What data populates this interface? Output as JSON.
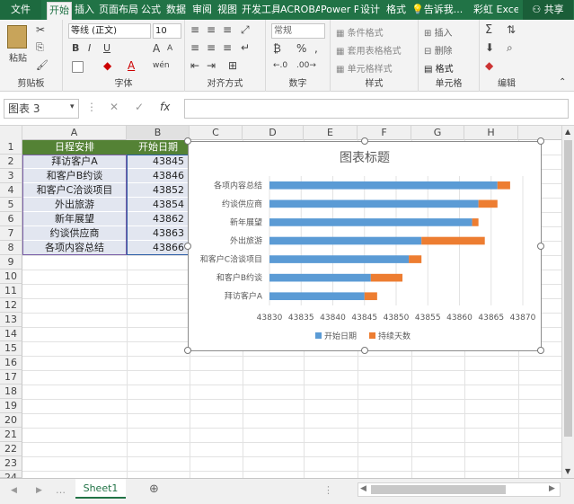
{
  "tabs": {
    "file": "文件",
    "home": "开始",
    "insert": "插入",
    "page_layout": "页面布局",
    "formulas": "公式",
    "data": "数据",
    "review": "审阅",
    "view": "视图",
    "developer": "开发工具",
    "acrobat": "ACROBAT",
    "powerpivot": "Power Pivot",
    "design": "设计",
    "format": "格式",
    "tell_me": "告诉我...",
    "user": "彩虹 Excel",
    "share": "共享"
  },
  "ribbon": {
    "clipboard": {
      "label": "剪贴板",
      "paste": "粘贴"
    },
    "font": {
      "label": "字体",
      "name": "等线 (正文)",
      "size": "10",
      "bold": "B",
      "italic": "I",
      "underline": "U",
      "grow": "A",
      "shrink": "A",
      "wen": "wén"
    },
    "alignment": {
      "label": "对齐方式"
    },
    "number": {
      "label": "数字",
      "format": "常规",
      "percent": "%",
      "comma": ","
    },
    "styles": {
      "label": "样式",
      "conditional": "条件格式",
      "table": "套用表格格式",
      "cell": "单元格样式"
    },
    "cells": {
      "label": "单元格",
      "insert": "插入",
      "delete": "删除",
      "format": "格式"
    },
    "editing": {
      "label": "编辑",
      "sigma": "Σ"
    }
  },
  "formula_bar": {
    "name_box": "图表 3",
    "fx": "fx",
    "value": ""
  },
  "columns": [
    "A",
    "B",
    "C",
    "D",
    "E",
    "F",
    "G",
    "H"
  ],
  "rows": [
    "1",
    "2",
    "3",
    "4",
    "5",
    "6",
    "7",
    "8",
    "9",
    "10",
    "11",
    "12",
    "13",
    "14",
    "15",
    "16",
    "17",
    "18",
    "19",
    "20",
    "21",
    "22",
    "23",
    "24"
  ],
  "table": {
    "header_a": "日程安排",
    "header_b": "开始日期",
    "col_a": [
      "拜访客户A",
      "和客户B约谈",
      "和客户C洽谈项目",
      "外出旅游",
      "新年展望",
      "约谈供应商",
      "各项内容总结"
    ],
    "col_b": [
      "43845",
      "43846",
      "43852",
      "43854",
      "43862",
      "43863",
      "43866"
    ]
  },
  "sheet_tab": "Sheet1",
  "add_sheet": "⊕",
  "colors": {
    "excel_green": "#217346",
    "series1": "#5b9bd5",
    "series2": "#ed7d31",
    "header_fill": "#548235"
  },
  "chart_data": {
    "type": "bar",
    "stacked": true,
    "horizontal": true,
    "title": "图表标题",
    "categories": [
      "拜访客户A",
      "和客户B约谈",
      "和客户C洽谈项目",
      "外出旅游",
      "新年展望",
      "约谈供应商",
      "各项内容总结"
    ],
    "series": [
      {
        "name": "开始日期",
        "color": "#5b9bd5",
        "values": [
          43845,
          43846,
          43852,
          43854,
          43862,
          43863,
          43866
        ]
      },
      {
        "name": "持续天数",
        "color": "#ed7d31",
        "values": [
          2,
          5,
          2,
          10,
          1,
          3,
          2
        ]
      }
    ],
    "xlim": [
      43830,
      43870
    ],
    "xticks": [
      "43830",
      "43835",
      "43840",
      "43845",
      "43850",
      "43855",
      "43860",
      "43865",
      "43870"
    ],
    "grid": true,
    "legend": "bottom"
  }
}
